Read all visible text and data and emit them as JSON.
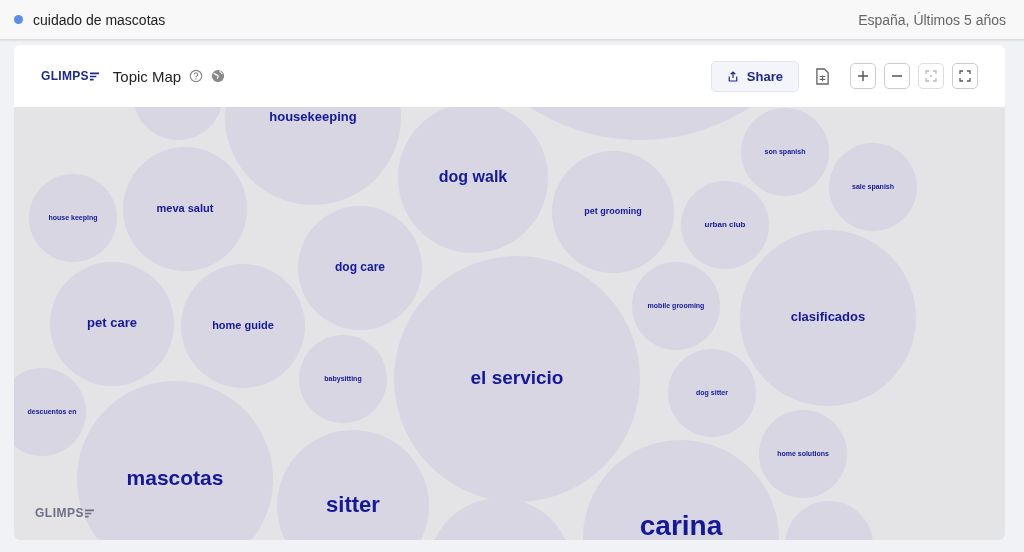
{
  "topbar": {
    "query": "cuidado de mascotas",
    "scope": "España, Últimos 5 años"
  },
  "header": {
    "logo": "GLIMPS",
    "title": "Topic Map",
    "share_label": "Share"
  },
  "bubbles": [
    {
      "label": "housekeeping"
    },
    {
      "label": "dog walk"
    },
    {
      "label": "pet grooming"
    },
    {
      "label": "urban club"
    },
    {
      "label": "son spanish"
    },
    {
      "label": "sale spanish"
    },
    {
      "label": "house keeping"
    },
    {
      "label": "meva salut"
    },
    {
      "label": "dog care"
    },
    {
      "label": "pet care"
    },
    {
      "label": "home guide"
    },
    {
      "label": "mobile grooming"
    },
    {
      "label": "clasificados"
    },
    {
      "label": "babysitting"
    },
    {
      "label": "el servicio"
    },
    {
      "label": "descuentos en"
    },
    {
      "label": "dog sitter"
    },
    {
      "label": "home solutions"
    },
    {
      "label": "mascotas"
    },
    {
      "label": "sitter"
    },
    {
      "label": "carina"
    }
  ],
  "watermark": "GLIMPS"
}
